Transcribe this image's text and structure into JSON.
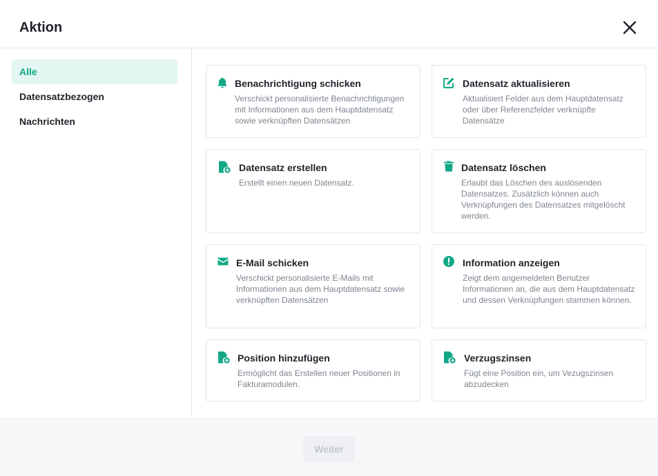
{
  "dialog": {
    "title": "Aktion"
  },
  "sidebar": {
    "items": [
      {
        "label": "Alle",
        "active": true
      },
      {
        "label": "Datensatzbezogen",
        "active": false
      },
      {
        "label": "Nachrichten",
        "active": false
      }
    ]
  },
  "actions": [
    {
      "icon": "bell-icon",
      "title": "Benachrichtigung schicken",
      "description": "Verschickt personalisierte Benachrichtigungen mit Informationen aus dem Hauptdatensatz sowie verknüpften Datensätzen"
    },
    {
      "icon": "edit-icon",
      "title": "Datensatz aktualisieren",
      "description": "Aktualisiert Felder aus dem Hauptdatensatz oder über Referenzfelder verknüpfte Datensätze"
    },
    {
      "icon": "file-add-icon",
      "title": "Datensatz erstellen",
      "description": "Erstellt einen neuen Datensatz."
    },
    {
      "icon": "trash-icon",
      "title": "Datensatz löschen",
      "description": "Erlaubt das Löschen des auslösenden Datensatzes. Zusätzlich können auch Verknüpfungen des Datensatzes mitgelöscht werden."
    },
    {
      "icon": "mail-icon",
      "title": "E-Mail schicken",
      "description": "Verschickt personalisierte E-Mails mit Informationen aus dem Hauptdatensatz sowie verknüpften Datensätzen"
    },
    {
      "icon": "info-icon",
      "title": "Information anzeigen",
      "description": "Zeigt dem angemeldeten Benutzer Informationen an, die aus dem Hauptdatensatz und dessen Verknüpfungen stammen können."
    },
    {
      "icon": "file-add-icon",
      "title": "Position hinzufügen",
      "description": "Ermöglicht das Erstellen neuer Positionen in Fakturamodulen."
    },
    {
      "icon": "file-add-icon",
      "title": "Verzugszinsen",
      "description": "Fügt eine Position ein, um Vezugszinsen abzudecken"
    }
  ],
  "footer": {
    "next_label": "Weiter",
    "next_enabled": false
  },
  "colors": {
    "accent": "#12a886",
    "active_bg": "#e3f6f1"
  }
}
